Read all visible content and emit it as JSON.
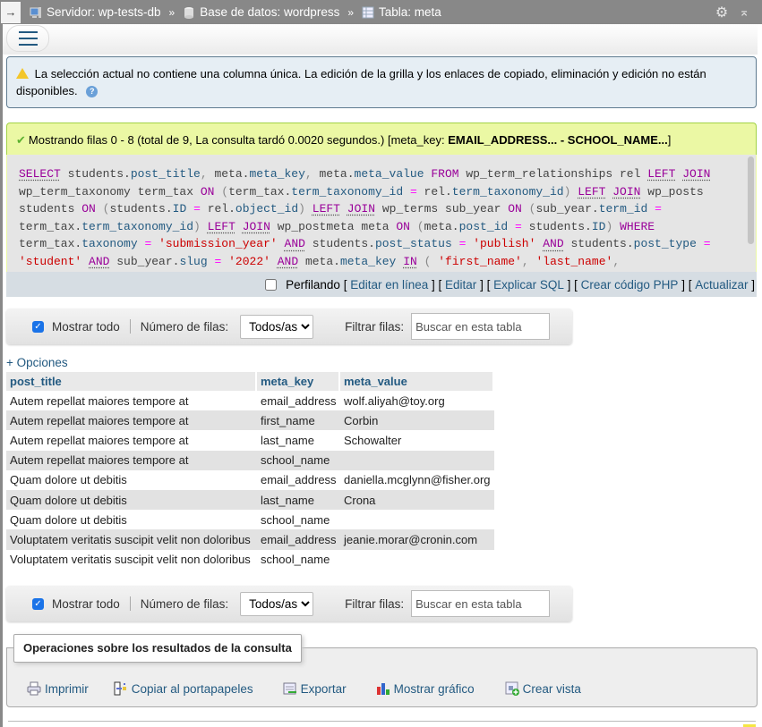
{
  "breadcrumb": {
    "server": "Servidor: wp-tests-db",
    "database": "Base de datos: wordpress",
    "table": "Tabla: meta",
    "separator": "»"
  },
  "notice": {
    "text": "La selección actual no contiene una columna única. La edición de la grilla y los enlaces de copiado, eliminación y edición no están disponibles."
  },
  "success": {
    "text": "Mostrando filas 0 - 8 (total de 9, La consulta tardó 0.0020 segundos.) [meta_key: ",
    "range_bold": "EMAIL_ADDRESS... - SCHOOL_NAME...",
    "close": "]"
  },
  "sql_lines": [
    "SELECT students.post_title, meta.meta_key, meta.meta_value FROM wp_term_relationships rel LEFT JOIN",
    "wp_term_taxonomy term_tax ON (term_tax.term_taxonomy_id = rel.term_taxonomy_id) LEFT JOIN wp_posts",
    "students ON (students.ID = rel.object_id) LEFT JOIN wp_terms sub_year ON (sub_year.term_id =",
    "term_tax.term_taxonomy_id) LEFT JOIN wp_postmeta meta ON (meta.post_id = students.ID) WHERE",
    "term_tax.taxonomy = 'submission_year' AND students.post_status = 'publish' AND students.post_type =",
    "'student' AND sub_year.slug = '2022' AND meta.meta_key IN ( 'first_name', 'last_name',"
  ],
  "sql_actions": {
    "profiling": "Perfilando",
    "links": [
      "Editar en línea",
      "Editar",
      "Explicar SQL",
      "Crear código PHP",
      "Actualizar"
    ]
  },
  "nav": {
    "show_all": "Mostrar todo",
    "rows_label": "Número de filas:",
    "rows_value": "Todos/as",
    "filter_label": "Filtrar filas:",
    "filter_placeholder": "Buscar en esta tabla"
  },
  "options_link": "+ Opciones",
  "table": {
    "headers": [
      "post_title",
      "meta_key",
      "meta_value"
    ],
    "rows": [
      [
        "Autem repellat maiores tempore at",
        "email_address",
        "wolf.aliyah@toy.org"
      ],
      [
        "Autem repellat maiores tempore at",
        "first_name",
        "Corbin"
      ],
      [
        "Autem repellat maiores tempore at",
        "last_name",
        "Schowalter"
      ],
      [
        "Autem repellat maiores tempore at",
        "school_name",
        ""
      ],
      [
        "Quam dolore ut debitis",
        "email_address",
        "daniella.mcglynn@fisher.org"
      ],
      [
        "Quam dolore ut debitis",
        "last_name",
        "Crona"
      ],
      [
        "Quam dolore ut debitis",
        "school_name",
        ""
      ],
      [
        "Voluptatem veritatis suscipit velit non doloribus",
        "email_address",
        "jeanie.morar@cronin.com"
      ],
      [
        "Voluptatem veritatis suscipit velit non doloribus",
        "school_name",
        ""
      ]
    ]
  },
  "operations": {
    "title": "Operaciones sobre los resultados de la consulta",
    "items": [
      {
        "label": "Imprimir",
        "icon": "print-icon"
      },
      {
        "label": "Copiar al portapapeles",
        "icon": "clipboard-icon"
      },
      {
        "label": "Exportar",
        "icon": "export-icon"
      },
      {
        "label": "Mostrar gráfico",
        "icon": "chart-icon"
      },
      {
        "label": "Crear vista",
        "icon": "create-view-icon"
      }
    ]
  },
  "colors": {
    "link": "#235a81",
    "success_bg": "#ebf8a4",
    "notice_bg": "#e6eef4",
    "topbar": "#888888"
  }
}
